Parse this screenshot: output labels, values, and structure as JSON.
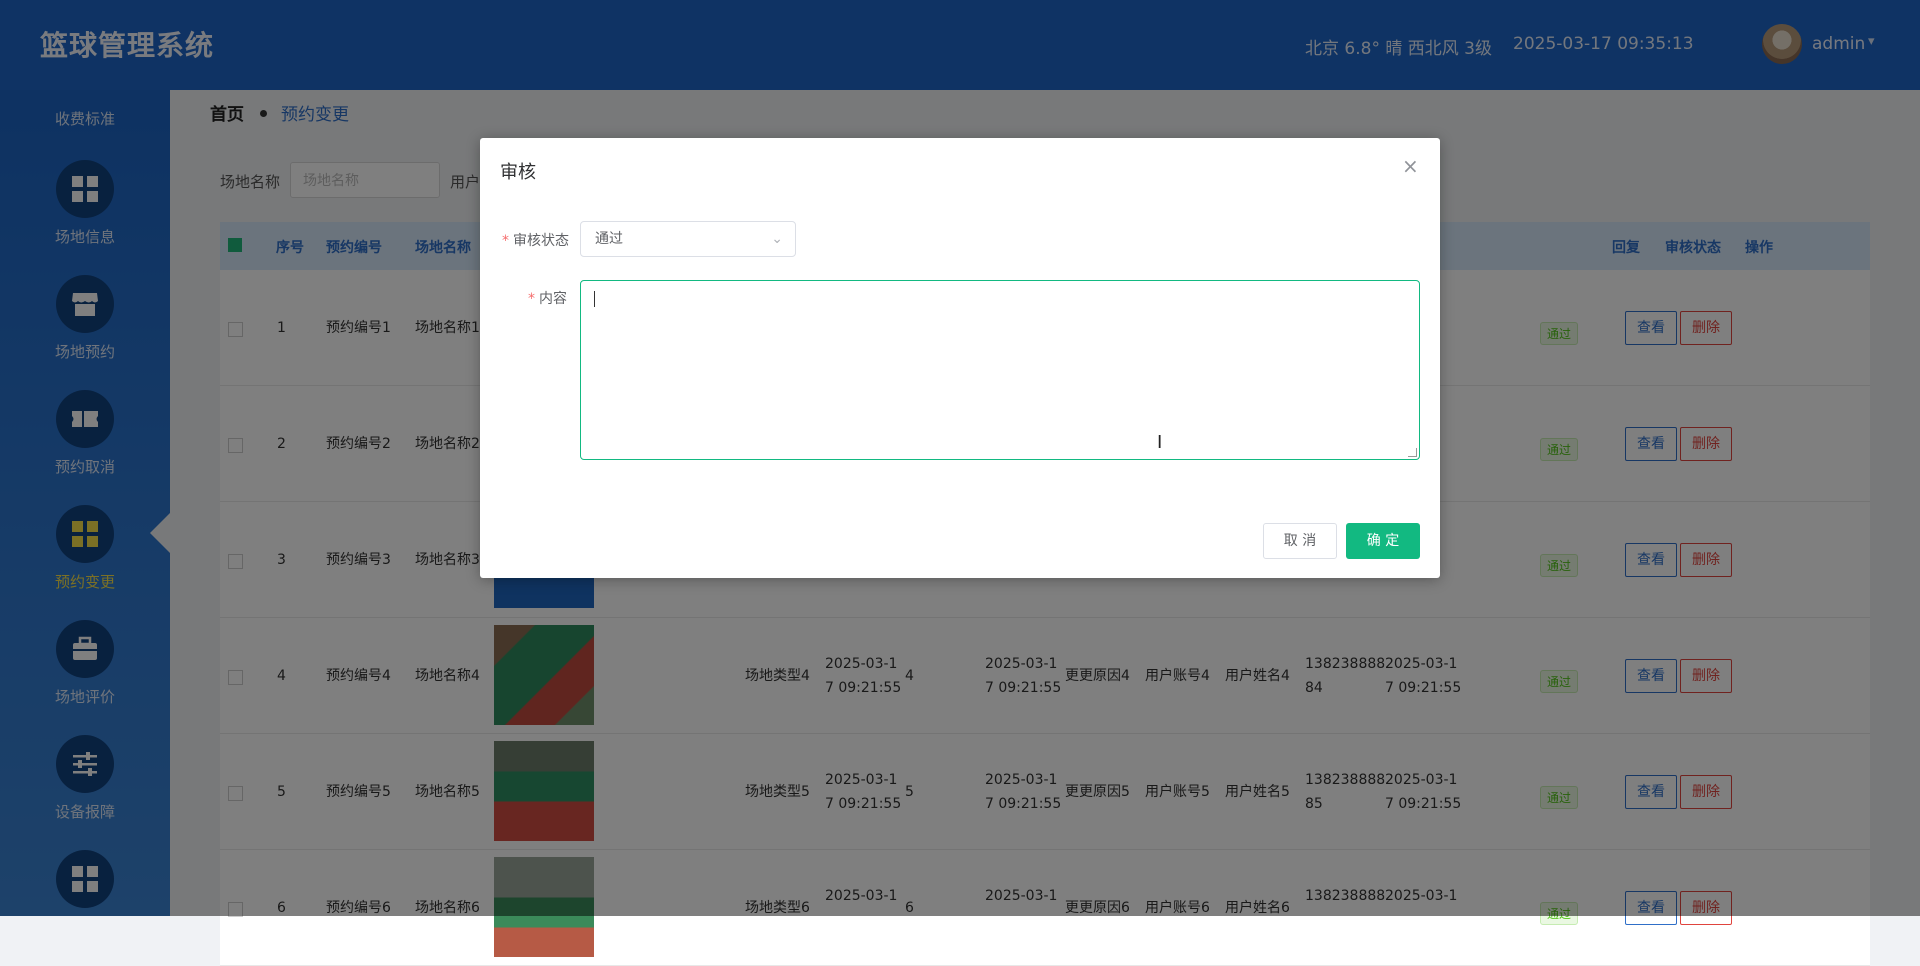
{
  "header": {
    "app_title": "篮球管理系统",
    "weather": "北京  6.8°  晴  西北风  3级",
    "datetime": "2025-03-17 09:35:13",
    "username": "admin",
    "caret": "▾"
  },
  "sidebar": {
    "top_label": "收费标准",
    "items": [
      {
        "label": "场地信息",
        "icon": "grid-icon"
      },
      {
        "label": "场地预约",
        "icon": "store-icon"
      },
      {
        "label": "预约取消",
        "icon": "ticket-icon"
      },
      {
        "label": "预约变更",
        "icon": "grid-icon",
        "active": true
      },
      {
        "label": "场地评价",
        "icon": "briefcase-icon"
      },
      {
        "label": "设备报障",
        "icon": "sliders-icon"
      },
      {
        "label": "",
        "icon": "grid-icon"
      }
    ]
  },
  "breadcrumb": {
    "home": "首页",
    "current": "预约变更"
  },
  "filter": {
    "label": "场地名称",
    "placeholder": "场地名称",
    "label2": "用户"
  },
  "table": {
    "headers": {
      "seq": "序号",
      "code": "预约编号",
      "name": "场地名称",
      "reply": "回复",
      "status": "审核状态",
      "action": "操作"
    },
    "rows": [
      {
        "seq": "1",
        "code": "预约编号1",
        "name": "场地名称1",
        "status": "通过",
        "view": "查看",
        "delete": "删除"
      },
      {
        "seq": "2",
        "code": "预约编号2",
        "name": "场地名称2",
        "status": "通过",
        "view": "查看",
        "delete": "删除"
      },
      {
        "seq": "3",
        "code": "预约编号3",
        "name": "场地名称3",
        "status": "通过",
        "view": "查看",
        "delete": "删除"
      },
      {
        "seq": "4",
        "code": "预约编号4",
        "name": "场地名称4",
        "type": "场地类型4",
        "date1": "2025-03-1\n7 09:21:55",
        "num": "4",
        "date2": "2025-03-1\n7 09:21:55",
        "reason": "更更原因4",
        "account": "用户账号4",
        "uname": "用户姓名4",
        "phone": "138238888\n84",
        "date3": "2025-03-1\n7 09:21:55",
        "status": "通过",
        "view": "查看",
        "delete": "删除"
      },
      {
        "seq": "5",
        "code": "预约编号5",
        "name": "场地名称5",
        "type": "场地类型5",
        "date1": "2025-03-1\n7 09:21:55",
        "num": "5",
        "date2": "2025-03-1\n7 09:21:55",
        "reason": "更更原因5",
        "account": "用户账号5",
        "uname": "用户姓名5",
        "phone": "138238888\n85",
        "date3": "2025-03-1\n7 09:21:55",
        "status": "通过",
        "view": "查看",
        "delete": "删除"
      },
      {
        "seq": "6",
        "code": "预约编号6",
        "name": "场地名称6",
        "type": "场地类型6",
        "date1": "2025-03-1",
        "num": "6",
        "date2": "2025-03-1",
        "reason": "更更原因6",
        "account": "用户账号6",
        "uname": "用户姓名6",
        "phone": "138238888",
        "date3": "2025-03-1",
        "status": "通过",
        "view": "查看",
        "delete": "删除"
      }
    ]
  },
  "dialog": {
    "title": "审核",
    "close": "×",
    "status_label": "审核状态",
    "status_value": "通过",
    "content_label": "内容",
    "content_value": "",
    "cancel": "取 消",
    "ok": "确 定"
  },
  "colors": {
    "header": "#1e66c9",
    "accent": "#12b981",
    "active_label": "#f6e04a"
  }
}
